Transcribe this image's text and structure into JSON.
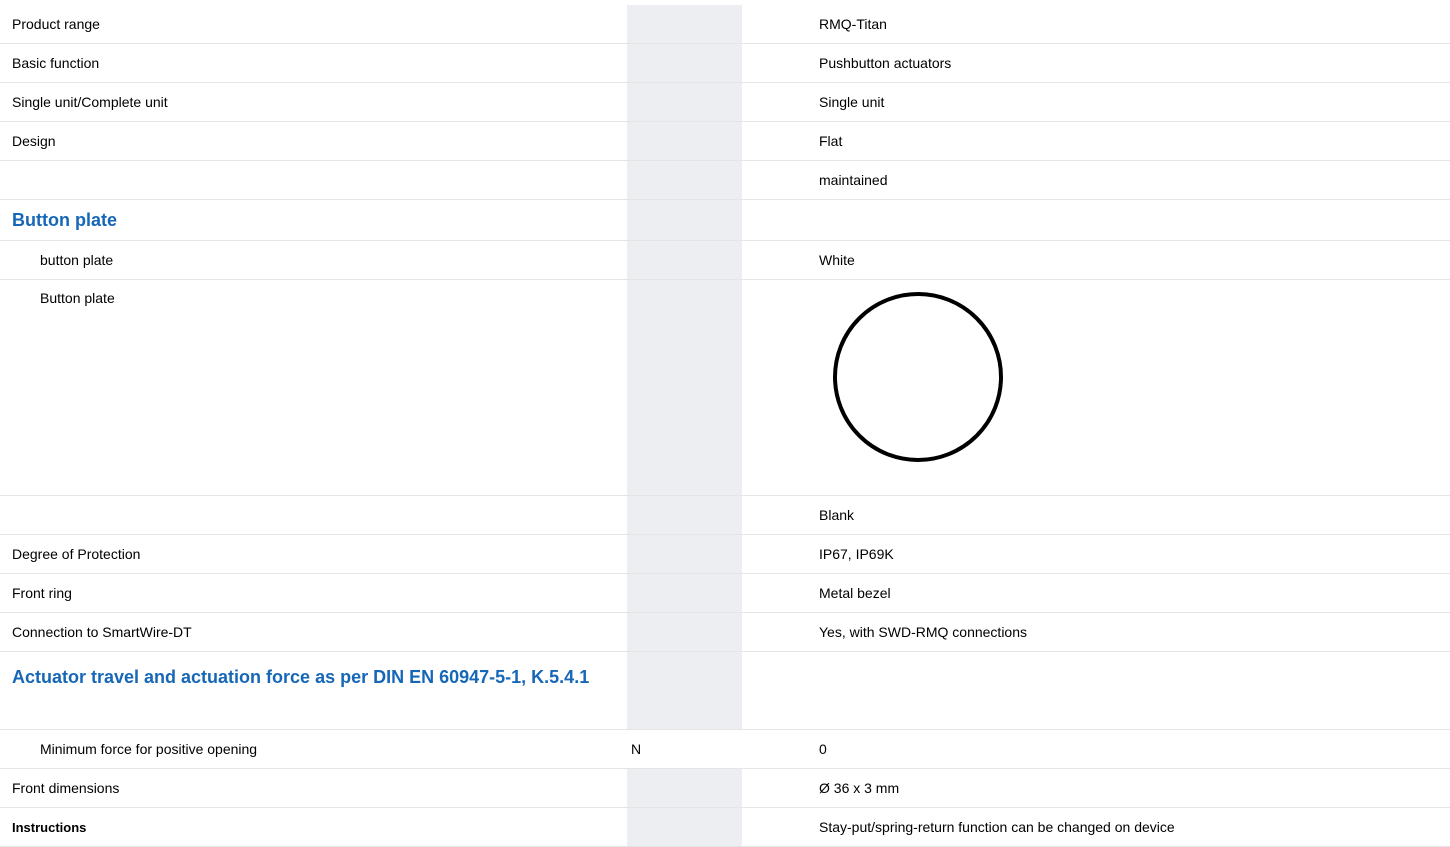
{
  "rows": [
    {
      "label": "Product range",
      "unit": "",
      "value": "RMQ-Titan"
    },
    {
      "label": "Basic function",
      "unit": "",
      "value": "Pushbutton actuators"
    },
    {
      "label": "Single unit/Complete unit",
      "unit": "",
      "value": "Single unit"
    },
    {
      "label": "Design",
      "unit": "",
      "value": "Flat"
    },
    {
      "label": "",
      "unit": "",
      "value": "maintained"
    }
  ],
  "button_plate": {
    "heading": "Button plate",
    "rows": [
      {
        "label": "button plate",
        "unit": "",
        "value": "White"
      },
      {
        "label": "Button plate",
        "unit": "",
        "value": "",
        "image_icon": "circle-outline-icon"
      }
    ]
  },
  "rows2": [
    {
      "label": "",
      "unit": "",
      "value": "Blank"
    },
    {
      "label": "Degree of Protection",
      "unit": "",
      "value": "IP67, IP69K"
    },
    {
      "label": "Front ring",
      "unit": "",
      "value": "Metal bezel"
    },
    {
      "label": "Connection to SmartWire-DT",
      "unit": "",
      "value": "Yes, with SWD-RMQ connections"
    }
  ],
  "actuator": {
    "heading": "Actuator travel and actuation force as per DIN EN 60947-5-1, K.5.4.1",
    "rows": [
      {
        "label": "Minimum force for positive opening",
        "unit": "N",
        "value": "0"
      }
    ]
  },
  "rows3": [
    {
      "label": "Front dimensions",
      "unit": "",
      "value": "Ø 36 x 3 mm"
    },
    {
      "label": "Instructions",
      "unit": "",
      "value": "Stay-put/spring-return function can be changed on device"
    }
  ],
  "colors": {
    "heading": "#1667b7",
    "unit_column_bg": "#eceef2",
    "row_divider": "#e5e5e5"
  }
}
